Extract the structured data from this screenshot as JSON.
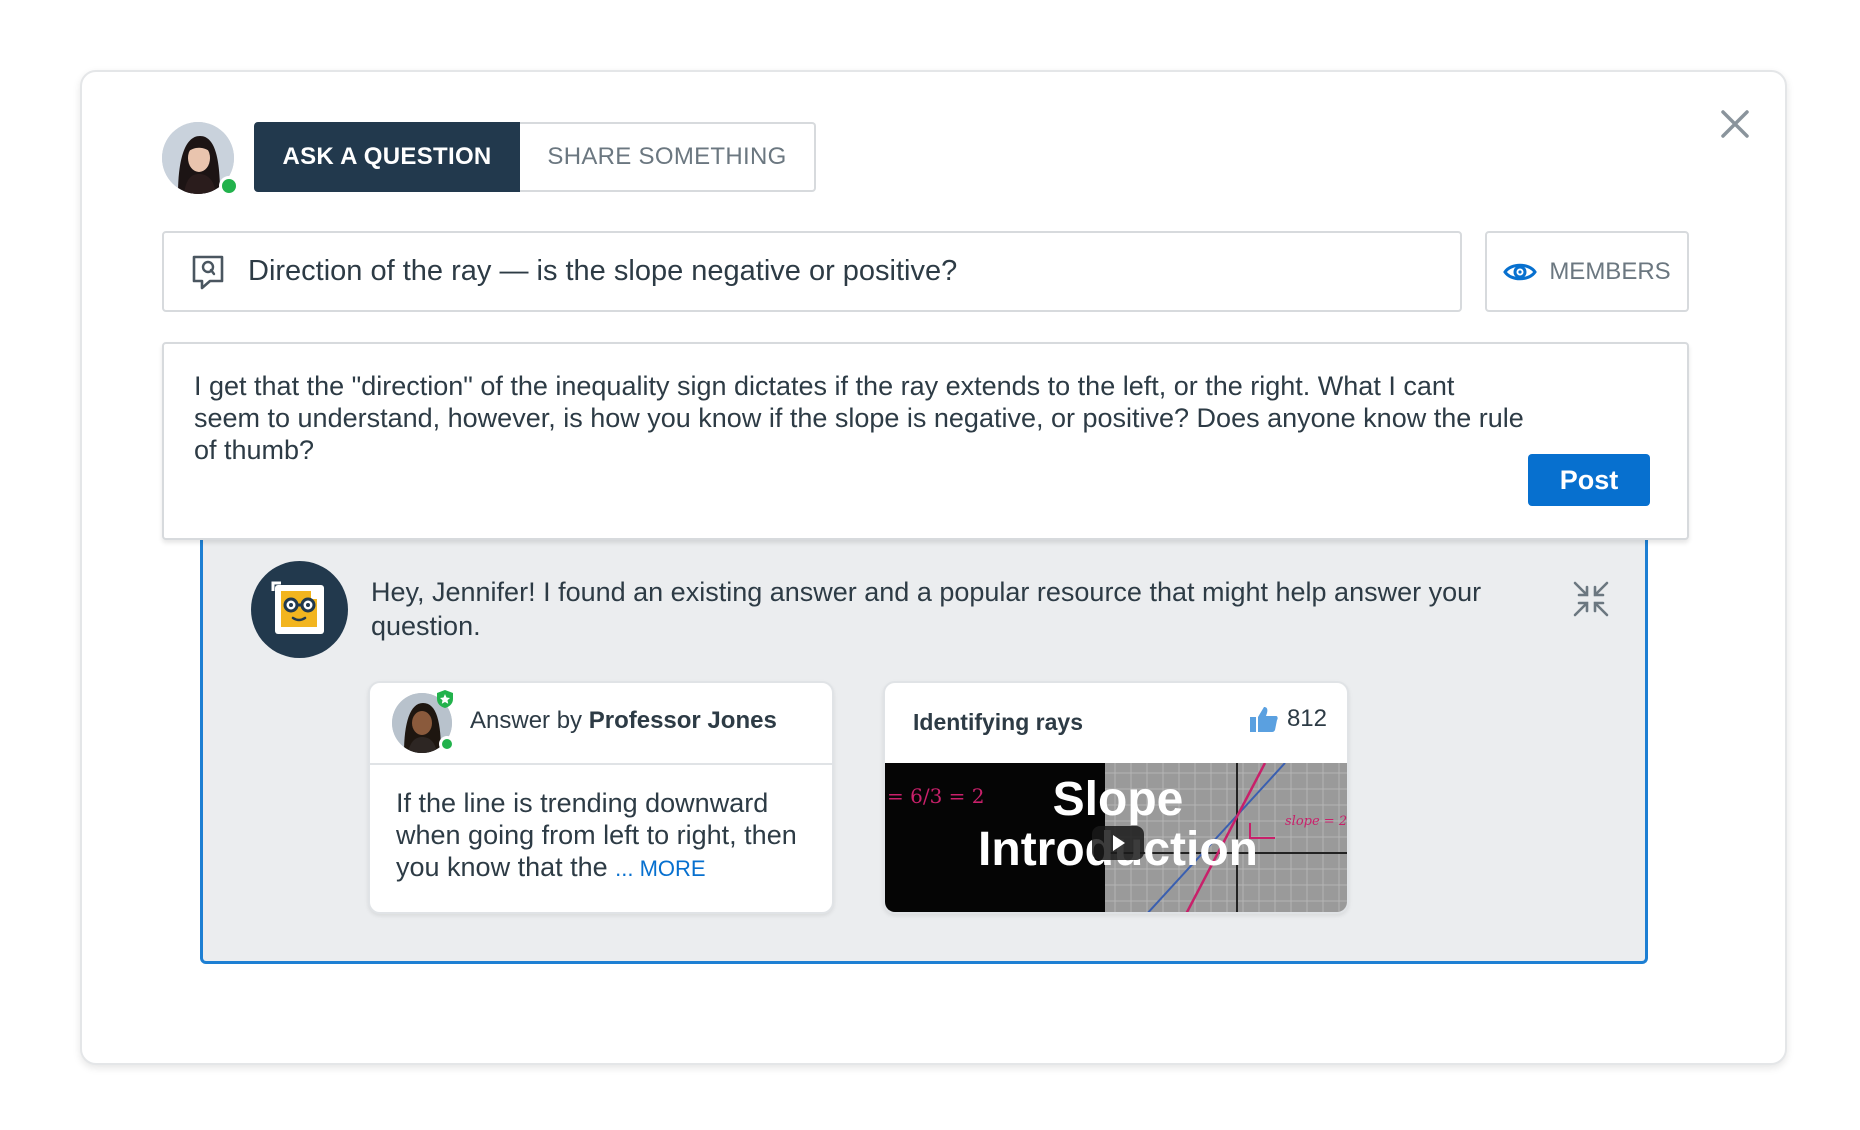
{
  "composer": {
    "tabs": [
      {
        "label": "ASK A QUESTION",
        "active": true
      },
      {
        "label": "SHARE SOMETHING",
        "active": false
      }
    ],
    "title_value": "Direction of the ray — is the slope negative or positive?",
    "visibility_label": "MEMBERS",
    "body_value": "I get that the \"direction\" of the inequality sign dictates if the ray extends to the left, or the right. What I cant seem to understand, however, is how you know if the slope is negative, or positive? Does anyone know the rule of thumb?",
    "post_label": "Post"
  },
  "suggestions": {
    "message": "Hey, Jennifer! I found an existing answer and a popular resource that might help answer your question.",
    "answer": {
      "prefix": "Answer by",
      "author": "Professor Jones",
      "excerpt": "If the line is trending downward when going from left to right, then you know that the",
      "more_label": "... MORE"
    },
    "resource": {
      "title": "Identifying rays",
      "likes": "812",
      "video_title_line1": "Slope",
      "video_title_line2": "Introduction",
      "video_chalk_text": "= 6/3 = 2",
      "video_graph_label": "slope = 2"
    }
  },
  "colors": {
    "active_tab": "#22394d",
    "primary": "#0770cf",
    "panel_border": "#1d7fd3",
    "panel_bg": "#ebedef",
    "online": "#22b24c",
    "text": "#2d3b45",
    "muted": "#6b7780"
  },
  "icons": [
    "close-icon",
    "question-icon",
    "eye-icon",
    "collapse-icon",
    "thumbs-up-icon",
    "play-icon",
    "bot-icon",
    "verified-badge-icon"
  ]
}
